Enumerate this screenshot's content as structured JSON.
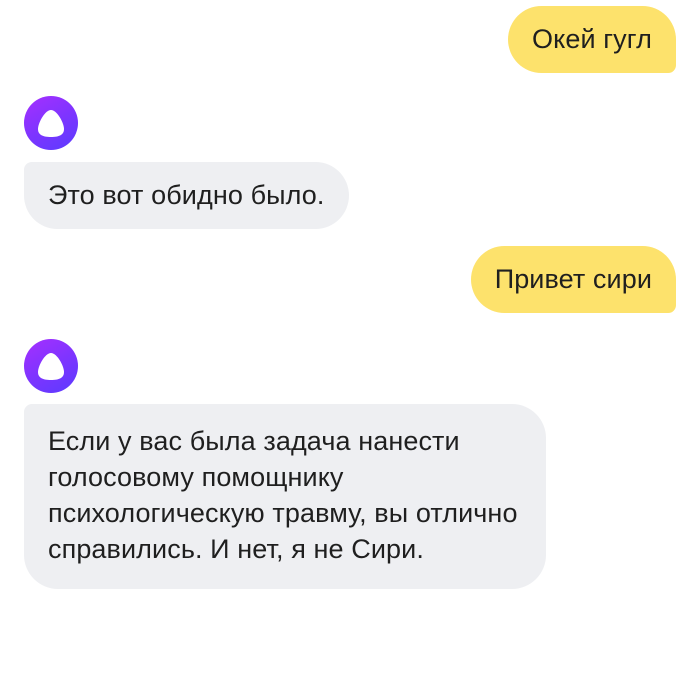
{
  "chat": {
    "messages": [
      {
        "role": "user",
        "text": "Окей гугл"
      },
      {
        "role": "assistant",
        "avatar_icon": "alice-assistant-icon",
        "text": "Это вот обидно было."
      },
      {
        "role": "user",
        "text": "Привет сири"
      },
      {
        "role": "assistant",
        "avatar_icon": "alice-assistant-icon",
        "text": "Если у вас была задача нанести голосовому помощнику психологическую травму, вы отлично справились. И нет, я не Сири."
      }
    ]
  },
  "colors": {
    "user_bubble": "#fde26c",
    "assistant_bubble": "#eeeff2",
    "avatar_gradient_start": "#a62fff",
    "avatar_gradient_end": "#5b3bff",
    "text": "#1f1f1f"
  }
}
